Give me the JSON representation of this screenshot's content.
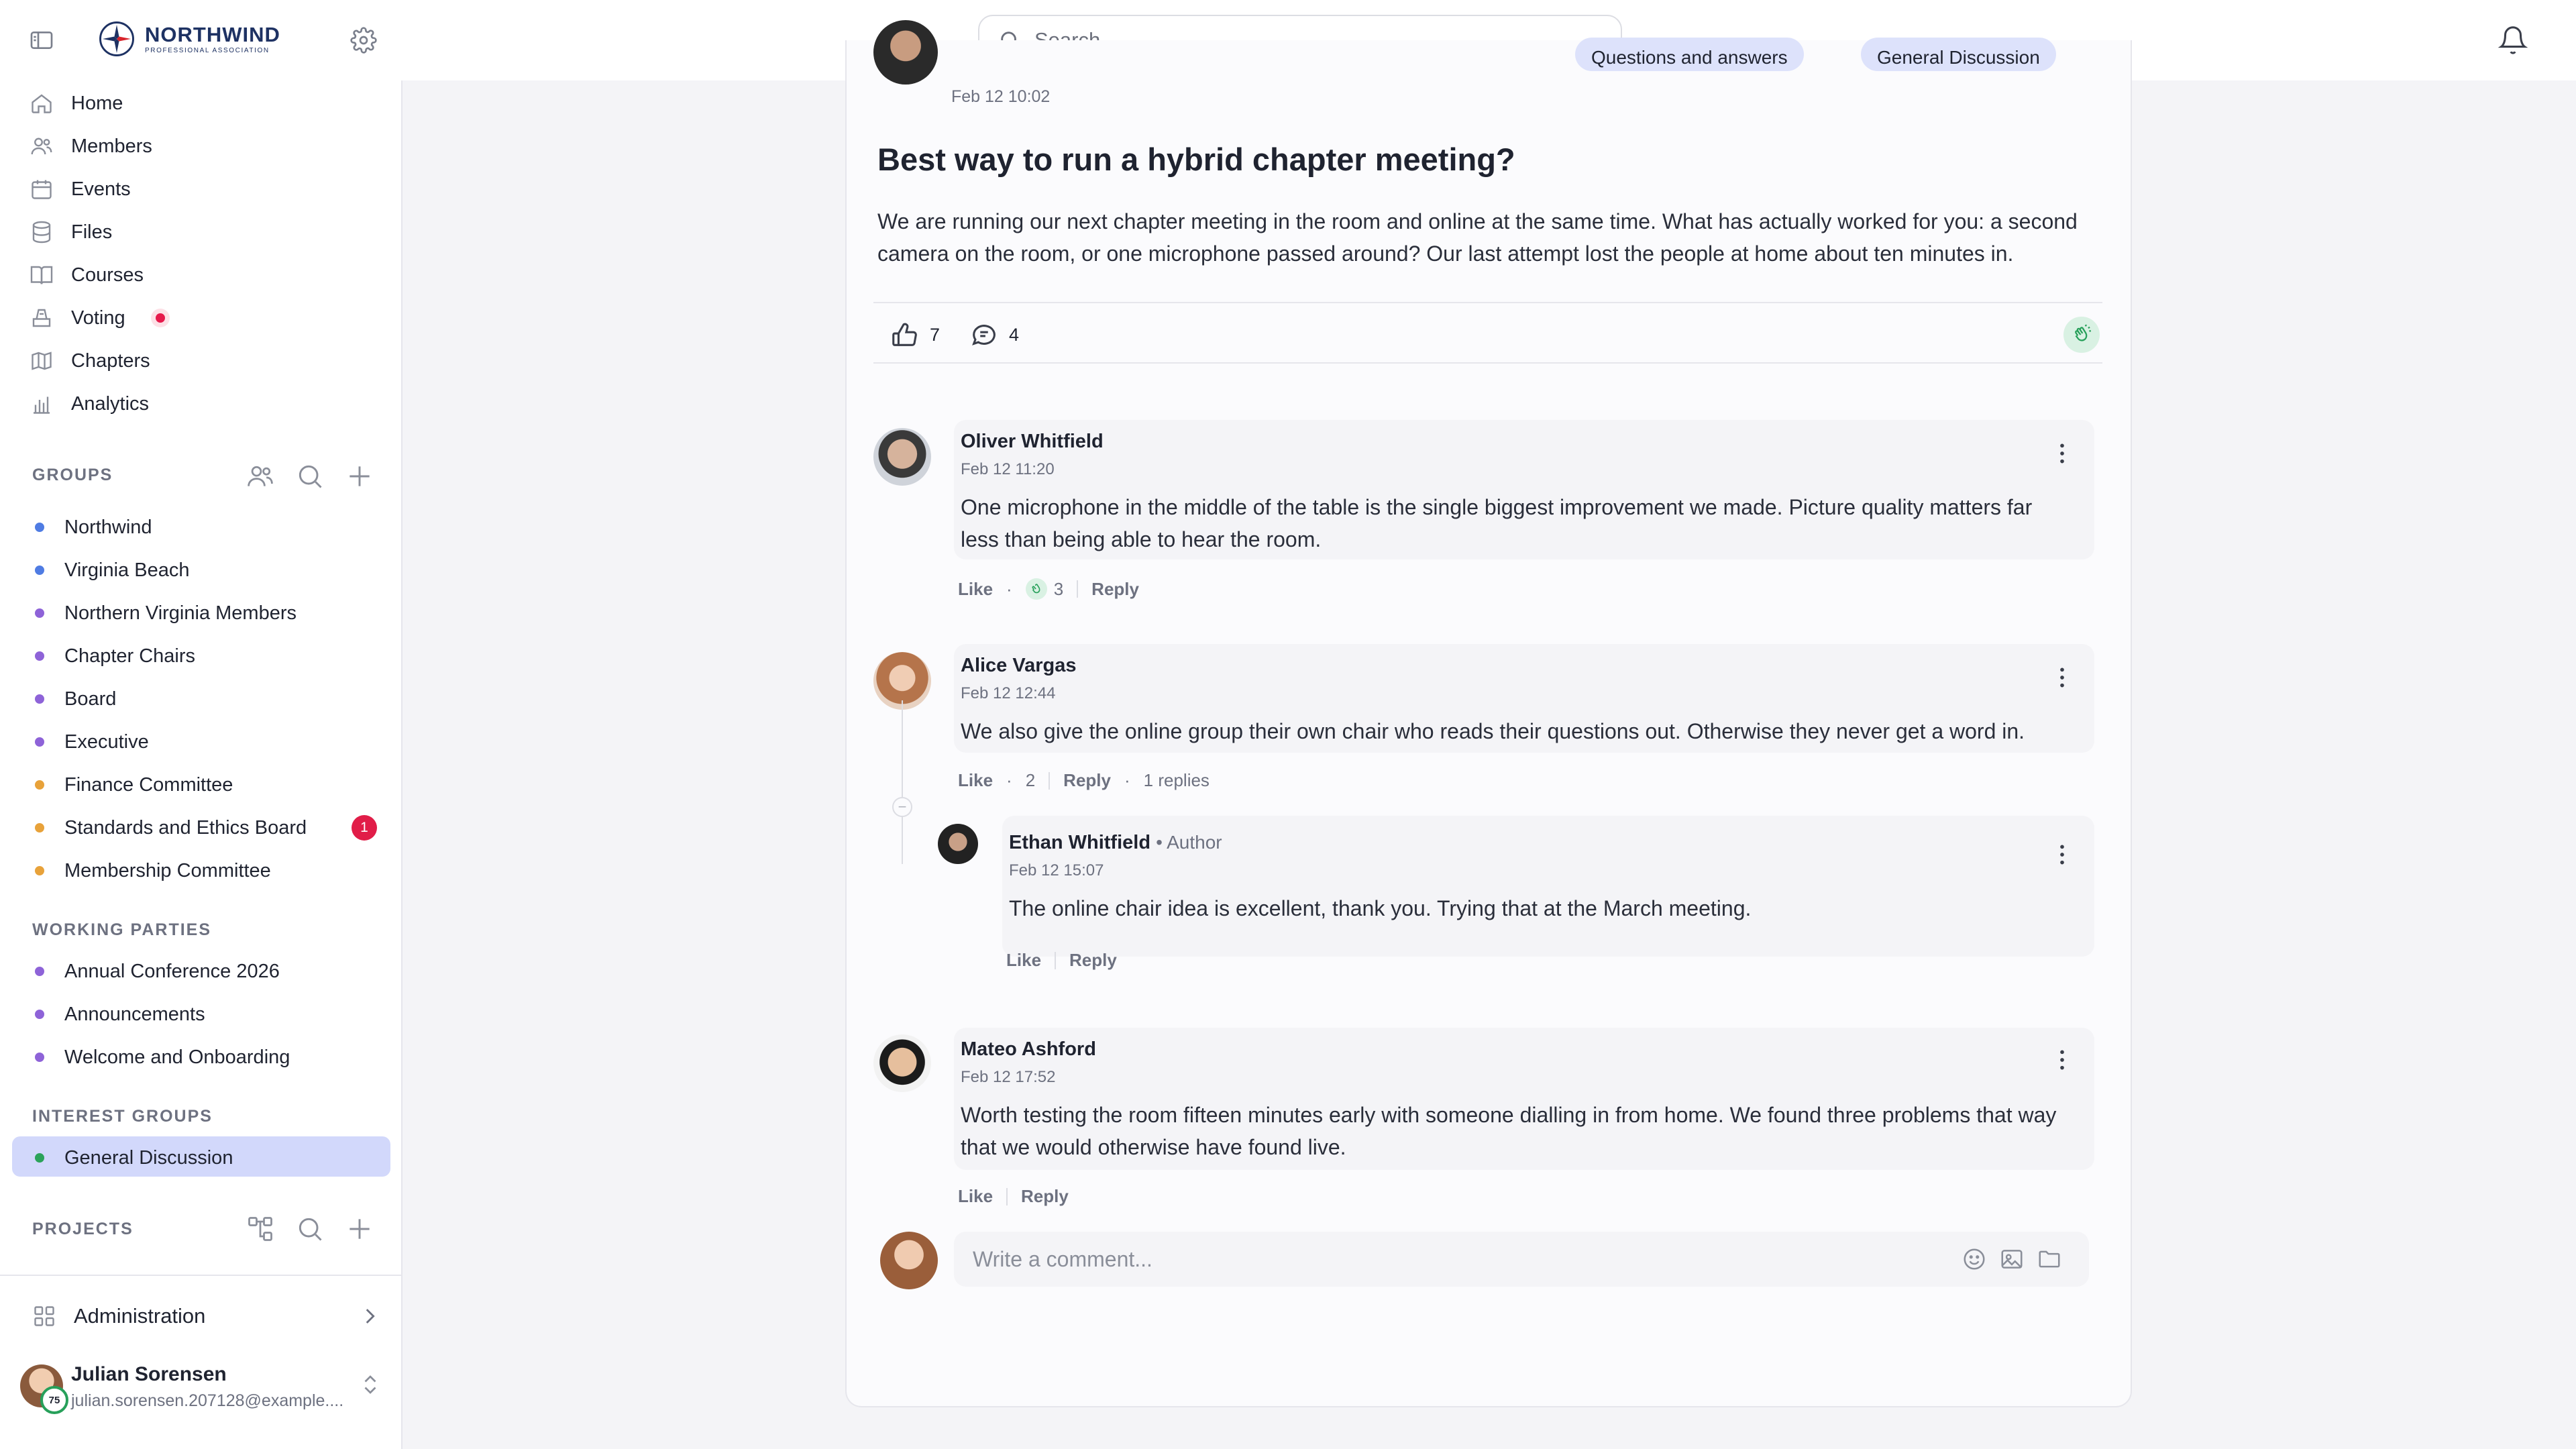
{
  "brand": {
    "name": "NORTHWIND",
    "subtitle": "PROFESSIONAL ASSOCIATION"
  },
  "search": {
    "placeholder": "Search"
  },
  "nav": [
    {
      "label": "Home",
      "icon": "home-icon"
    },
    {
      "label": "Members",
      "icon": "members-icon"
    },
    {
      "label": "Events",
      "icon": "calendar-icon"
    },
    {
      "label": "Files",
      "icon": "database-icon"
    },
    {
      "label": "Courses",
      "icon": "book-icon"
    },
    {
      "label": "Voting",
      "icon": "ballot-icon",
      "indicator": "red-dot"
    },
    {
      "label": "Chapters",
      "icon": "map-icon"
    },
    {
      "label": "Analytics",
      "icon": "chart-icon"
    }
  ],
  "sections": {
    "groups": "GROUPS",
    "working_parties": "WORKING PARTIES",
    "interest_groups": "INTEREST GROUPS",
    "projects": "PROJECTS"
  },
  "groups": [
    {
      "label": "Northwind",
      "color": "#4f7ce3"
    },
    {
      "label": "Virginia Beach",
      "color": "#4f7ce3"
    },
    {
      "label": "Northern Virginia Members",
      "color": "#8e63d8"
    },
    {
      "label": "Chapter Chairs",
      "color": "#8e63d8"
    },
    {
      "label": "Board",
      "color": "#8e63d8"
    },
    {
      "label": "Executive",
      "color": "#8e63d8"
    },
    {
      "label": "Finance Committee",
      "color": "#e8a23a"
    },
    {
      "label": "Standards and Ethics Board",
      "color": "#e8a23a",
      "badge": "1"
    },
    {
      "label": "Membership Committee",
      "color": "#e8a23a"
    }
  ],
  "working_parties": [
    {
      "label": "Annual Conference 2026"
    },
    {
      "label": "Announcements"
    },
    {
      "label": "Welcome and Onboarding"
    }
  ],
  "interest_groups": [
    {
      "label": "General Discussion",
      "active": true,
      "color": "#2ba35a"
    }
  ],
  "admin": {
    "label": "Administration"
  },
  "user": {
    "name": "Julian Sorensen",
    "email": "julian.sorensen.207128@example....",
    "score": "75"
  },
  "post": {
    "date": "Feb 12 10:02",
    "tags": [
      "Questions and answers",
      "General Discussion"
    ],
    "title": "Best way to run a hybrid chapter meeting?",
    "body": "We are running our next chapter meeting in the room and online at the same time. What has actually worked for you: a second camera on the room, or one microphone passed around? Our last attempt lost the people at home about ten minutes in.",
    "likes": "7",
    "comments": "4"
  },
  "comments": [
    {
      "name": "Oliver Whitfield",
      "date": "Feb 12 11:20",
      "text": "One microphone in the middle of the table is the single biggest improvement we made. Picture quality matters far less than being able to hear the room.",
      "like": "Like",
      "reaction_count": "3",
      "reply": "Reply"
    },
    {
      "name": "Alice Vargas",
      "date": "Feb 12 12:44",
      "text": "We also give the online group their own chair who reads their questions out. Otherwise they never get a word in.",
      "like": "Like",
      "like_count": "2",
      "reply": "Reply",
      "replies": "1 replies"
    },
    {
      "name": "Ethan Whitfield",
      "author_tag": "• Author",
      "date": "Feb 12 15:07",
      "text": "The online chair idea is excellent, thank you. Trying that at the March meeting.",
      "like": "Like",
      "reply": "Reply"
    },
    {
      "name": "Mateo Ashford",
      "date": "Feb 12 17:52",
      "text": "Worth testing the room fifteen minutes early with someone dialling in from home. We found three problems that way that we would otherwise have found live.",
      "like": "Like",
      "reply": "Reply"
    }
  ],
  "composer": {
    "placeholder": "Write a comment..."
  }
}
